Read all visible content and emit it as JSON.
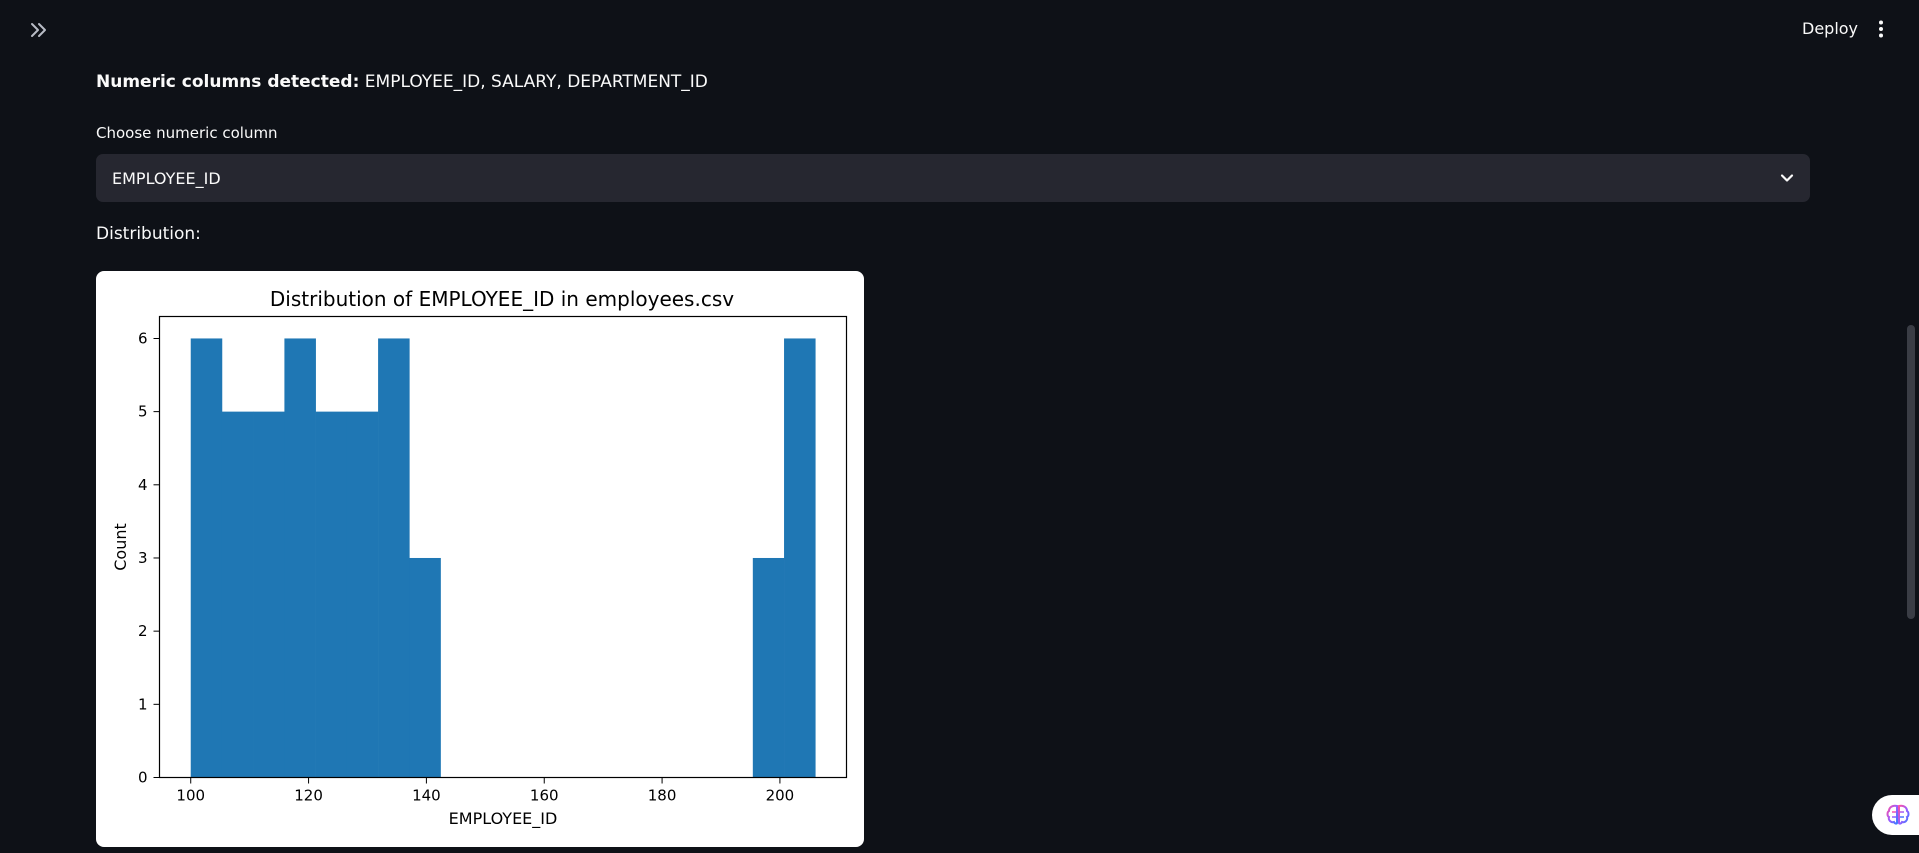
{
  "header": {
    "collapse_icon": "double-chevron-right-icon",
    "deploy_label": "Deploy",
    "menu_icon": "vertical-ellipsis-icon"
  },
  "main": {
    "numeric_prefix": "Numeric columns detected:",
    "numeric_columns": "EMPLOYEE_ID, SALARY, DEPARTMENT_ID",
    "select_label": "Choose numeric column",
    "select_value": "EMPLOYEE_ID",
    "distribution_label": "Distribution:"
  },
  "chart_data": {
    "type": "bar",
    "title": "Distribution of EMPLOYEE_ID in employees.csv",
    "xlabel": "EMPLOYEE_ID",
    "ylabel": "Count",
    "xlim": [
      94.7,
      211.3
    ],
    "ylim": [
      0,
      6.3
    ],
    "x_ticks": [
      100,
      120,
      140,
      160,
      180,
      200
    ],
    "y_ticks": [
      0,
      1,
      2,
      3,
      4,
      5,
      6
    ],
    "bin_edges": [
      100,
      105.3,
      110.6,
      115.9,
      121.2,
      126.5,
      131.8,
      137.1,
      142.4,
      147.7,
      153.0,
      158.3,
      163.6,
      168.9,
      174.2,
      179.5,
      184.8,
      190.1,
      195.4,
      200.7,
      206
    ],
    "values": [
      6,
      5,
      5,
      6,
      5,
      5,
      6,
      3,
      0,
      0,
      0,
      0,
      0,
      0,
      0,
      0,
      0,
      0,
      3,
      6
    ],
    "bar_color": "#1f77b4",
    "grid": false
  },
  "colors": {
    "background": "#0e1117",
    "select_background": "#262730",
    "text": "#fafafa"
  },
  "floating": {
    "brain_icon": "brain-icon"
  }
}
